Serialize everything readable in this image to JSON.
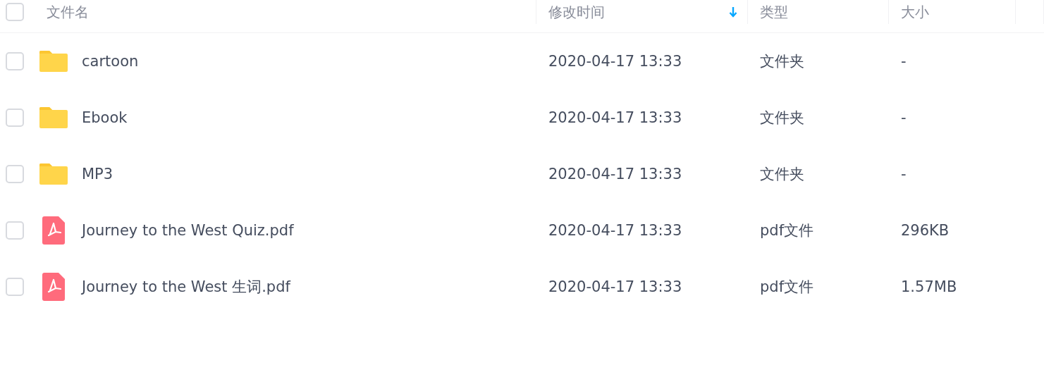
{
  "header": {
    "checked": false,
    "columns": [
      {
        "label": "文件名",
        "sorted": false
      },
      {
        "label": "修改时间",
        "sorted": true
      },
      {
        "label": "类型",
        "sorted": false
      },
      {
        "label": "大小",
        "sorted": false
      }
    ]
  },
  "rows": [
    {
      "kind": "folder",
      "checked": false,
      "name": "cartoon",
      "modified": "2020-04-17 13:33",
      "type": "文件夹",
      "size": "-"
    },
    {
      "kind": "folder",
      "checked": false,
      "name": "Ebook",
      "modified": "2020-04-17 13:33",
      "type": "文件夹",
      "size": "-"
    },
    {
      "kind": "folder",
      "checked": false,
      "name": "MP3",
      "modified": "2020-04-17 13:33",
      "type": "文件夹",
      "size": "-"
    },
    {
      "kind": "pdf",
      "checked": false,
      "name": "Journey to the West Quiz.pdf",
      "modified": "2020-04-17 13:33",
      "type": "pdf文件",
      "size": "296KB"
    },
    {
      "kind": "pdf",
      "checked": false,
      "name": "Journey to the West 生词.pdf",
      "modified": "2020-04-17 13:33",
      "type": "pdf文件",
      "size": "1.57MB"
    }
  ]
}
